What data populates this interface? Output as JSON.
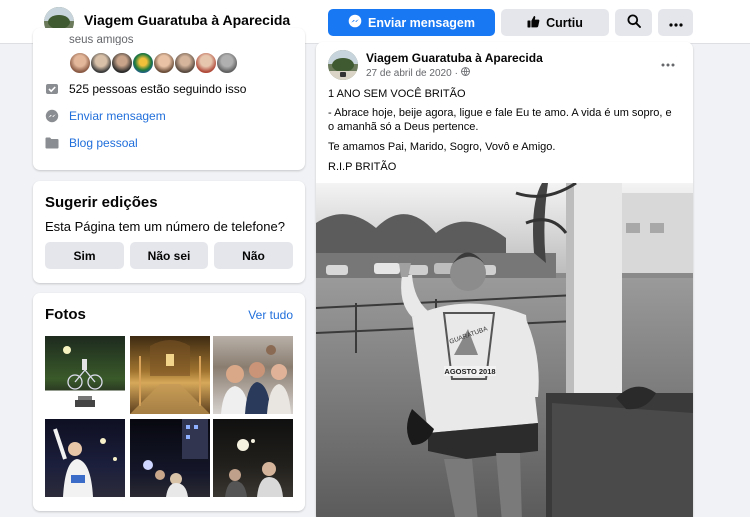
{
  "header": {
    "page_name": "Viagem Guaratuba à Aparecida",
    "message_button": "Enviar mensagem",
    "like_button": "Curtiu"
  },
  "about": {
    "friends_text_cut": "seus amigos",
    "followers": "525 pessoas estão seguindo isso",
    "send_message": "Enviar mensagem",
    "blog": "Blog pessoal"
  },
  "suggest": {
    "title": "Sugerir edições",
    "question": "Esta Página tem um número de telefone?",
    "yes": "Sim",
    "dont_know": "Não sei",
    "no": "Não"
  },
  "photos": {
    "title": "Fotos",
    "see_all": "Ver tudo"
  },
  "post": {
    "author": "Viagem Guaratuba à Aparecida",
    "date": "27 de abril de 2020",
    "dot": "·",
    "line1": "1 ANO SEM VOCÊ BRITÃO",
    "line2a": "- Abrace hoje, beije agora, ligue e fale Eu te amo. A vida é um sopro, e",
    "line2b": "o amanhã só a Deus pertence.",
    "line3": "Te amamos Pai, Marido, Sogro, Vovô e Amigo.",
    "line4": "R.I.P BRITÃO",
    "shirt_text1": "GUARATUBA",
    "shirt_text2": "AGOSTO 2018"
  },
  "colors": {
    "brand": "#1877f2",
    "link": "#216fdb",
    "background": "#f0f2f5"
  }
}
